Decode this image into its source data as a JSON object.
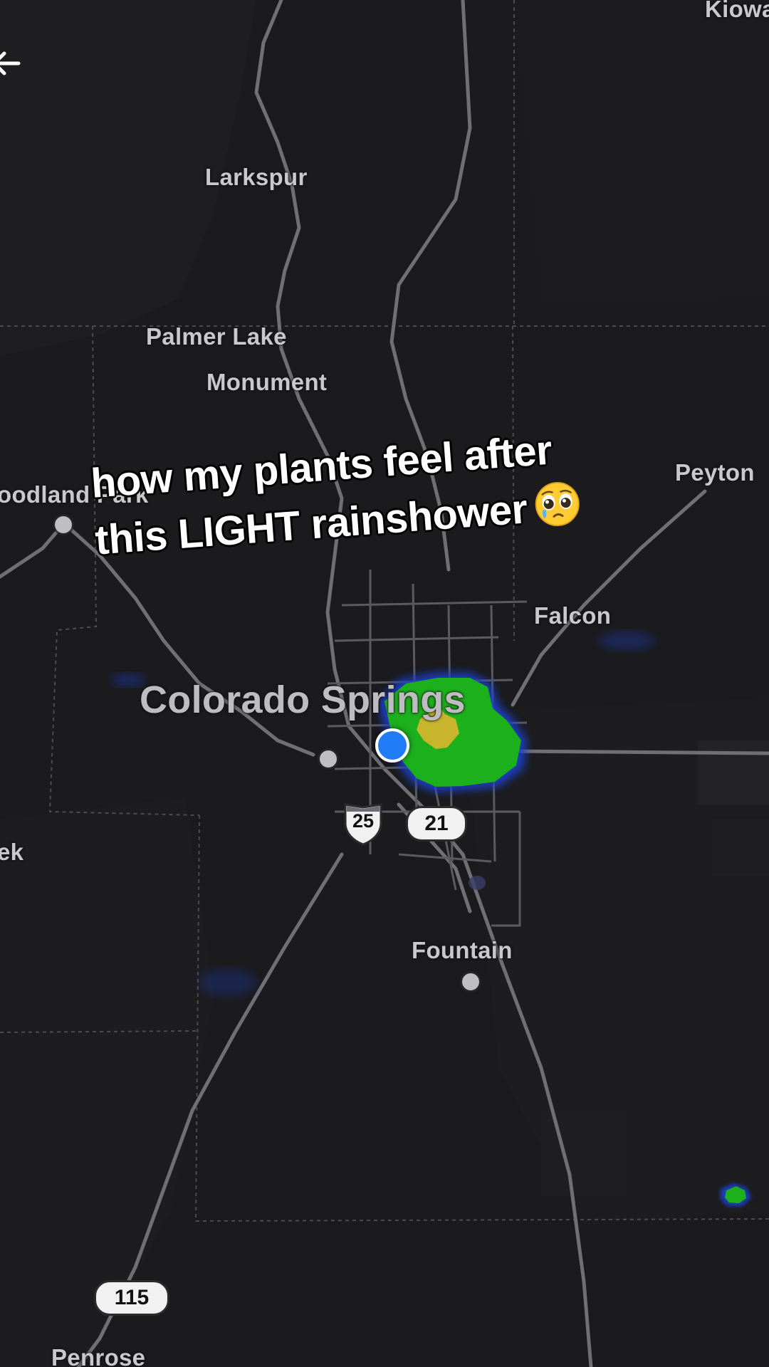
{
  "caption": {
    "line1": "how my plants feel after",
    "line2": "this LIGHT rainshower",
    "emoji": "pleading-face-with-tear-emoji"
  },
  "map": {
    "places": {
      "kiowa": "Kiowa",
      "larkspur": "Larkspur",
      "palmer_lake": "Palmer Lake",
      "monument": "Monument",
      "woodland_park": "oodland Park",
      "peyton": "Peyton",
      "falcon": "Falcon",
      "colorado_springs": "Colorado Springs",
      "ek_partial": "ek",
      "fountain": "Fountain",
      "penrose": "Penrose"
    },
    "routes": {
      "interstate": "25",
      "state_21": "21",
      "state_115": "115"
    },
    "radar_colors": {
      "light": "#1db01d",
      "moderate": "#c9b52c",
      "edge": "#1a3fd0"
    },
    "location_color": "#1f7cf6"
  },
  "nav": {
    "back_icon": "back-arrow-icon"
  }
}
